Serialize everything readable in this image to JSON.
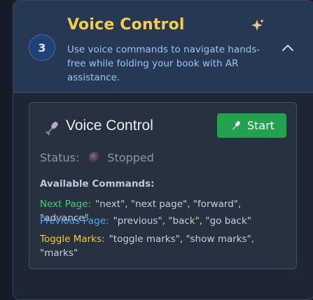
{
  "step": {
    "number": "3",
    "title": "Voice Control",
    "description": "Use voice commands to navigate hands-free while folding your book with AR assistance."
  },
  "panel": {
    "title": "Voice Control",
    "start_label": "Start",
    "status_label": "Status:",
    "status_value": "Stopped",
    "commands_heading": "Available Commands:",
    "commands": [
      {
        "key": "Next Page:",
        "phrases": "\"next\", \"next page\", \"forward\", \"advance\""
      },
      {
        "key": "Previous Page:",
        "phrases": "\"previous\", \"back\", \"go back\""
      },
      {
        "key": "Toggle Marks:",
        "phrases": "\"toggle marks\", \"show marks\", \"marks\""
      }
    ]
  },
  "colors": {
    "accent_title": "#f5cd4a",
    "start_button": "#22a24f",
    "next_key": "#3fd07a",
    "prev_key": "#5aa2f5",
    "toggle_key": "#f3c93e"
  },
  "icons": [
    "sparkle-icon",
    "chevron-up-icon",
    "microphone-icon"
  ]
}
